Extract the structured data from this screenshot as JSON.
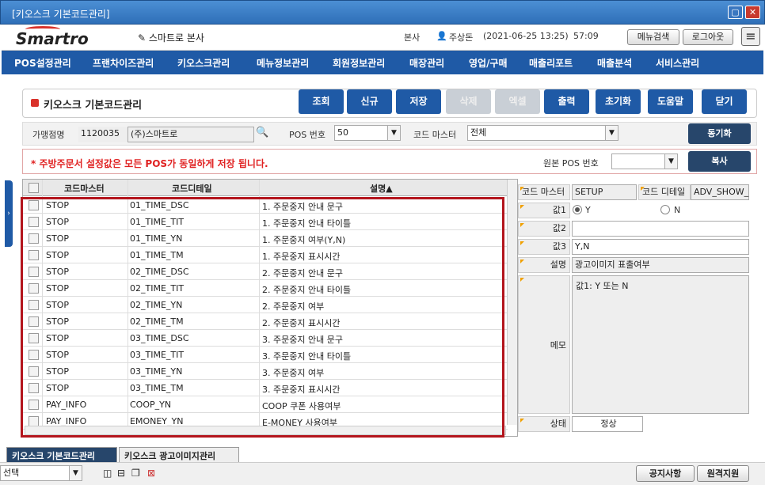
{
  "window": {
    "title": "[키오스크 기본코드관리]"
  },
  "header": {
    "logo": "Smartro",
    "store": "스마트로 본사",
    "region": "본사",
    "user": "주상돈",
    "login_time": "(2021-06-25 13:25)",
    "clock": "57:09",
    "menu_search": "메뉴검색",
    "logout": "로그아웃"
  },
  "nav": [
    "POS설정관리",
    "프랜차이즈관리",
    "키오스크관리",
    "메뉴정보관리",
    "회원정보관리",
    "매장관리",
    "영업/구매",
    "매출리포트",
    "매출분석",
    "서비스관리"
  ],
  "page": {
    "title": "키오스크 기본코드관리"
  },
  "actions": {
    "search": "조회",
    "new": "신규",
    "save": "저장",
    "delete": "삭제",
    "excel": "엑셀",
    "print": "출력",
    "reset": "초기화",
    "help": "도움말",
    "close": "닫기"
  },
  "filters": {
    "store_label": "가맹점명",
    "store_code": "1120035",
    "store_name": "(주)스마트로",
    "pos_label": "POS 번호",
    "pos_value": "50",
    "code_master_label": "코드 마스터",
    "code_master_value": "전체",
    "sync": "동기화",
    "notice": "* 주방주문서 설정값은 모든 POS가 동일하게 저장 됩니다.",
    "source_pos_label": "원본 POS 번호",
    "source_pos_value": "",
    "copy": "복사"
  },
  "grid": {
    "headers": [
      "코드마스터",
      "코드디테일",
      "설명▲"
    ],
    "rows": [
      [
        "STOP",
        "01_TIME_DSC",
        "1. 주문중지 안내 문구"
      ],
      [
        "STOP",
        "01_TIME_TIT",
        "1. 주문중지 안내 타이틀"
      ],
      [
        "STOP",
        "01_TIME_YN",
        "1. 주문중지 여부(Y,N)"
      ],
      [
        "STOP",
        "01_TIME_TM",
        "1. 주문중지 표시시간"
      ],
      [
        "STOP",
        "02_TIME_DSC",
        "2. 주문중지 안내 문구"
      ],
      [
        "STOP",
        "02_TIME_TIT",
        "2. 주문중지 안내 타이틀"
      ],
      [
        "STOP",
        "02_TIME_YN",
        "2. 주문중지 여부"
      ],
      [
        "STOP",
        "02_TIME_TM",
        "2. 주문중지 표시시간"
      ],
      [
        "STOP",
        "03_TIME_DSC",
        "3. 주문중지 안내 문구"
      ],
      [
        "STOP",
        "03_TIME_TIT",
        "3. 주문중지 안내 타이틀"
      ],
      [
        "STOP",
        "03_TIME_YN",
        "3. 주문중지 여부"
      ],
      [
        "STOP",
        "03_TIME_TM",
        "3. 주문중지 표시시간"
      ],
      [
        "PAY_INFO",
        "COOP_YN",
        "COOP 쿠폰 사용여부"
      ],
      [
        "PAY_INFO",
        "EMONEY_YN",
        "E-MONEY 사용여부"
      ]
    ]
  },
  "detail": {
    "code_master_label": "코드 마스터",
    "code_master_value": "SETUP",
    "code_detail_label": "코드 디테일",
    "code_detail_value": "ADV_SHOW_",
    "value1_label": "값1",
    "radio_y": "Y",
    "radio_n": "N",
    "value2_label": "값2",
    "value2": "",
    "value3_label": "값3",
    "value3": "Y,N",
    "desc_label": "설명",
    "desc_value": "광고이미지 표출여부",
    "memo_label": "메모",
    "memo_value": "값1: Y 또는 N",
    "status_label": "상태",
    "status_value": "정상"
  },
  "tabs": [
    "키오스크 기본코드관리",
    "키오스크 광고이미지관리"
  ],
  "status": {
    "select_value": "선택",
    "notice_btn": "공지사항",
    "remote_btn": "원격지원"
  }
}
